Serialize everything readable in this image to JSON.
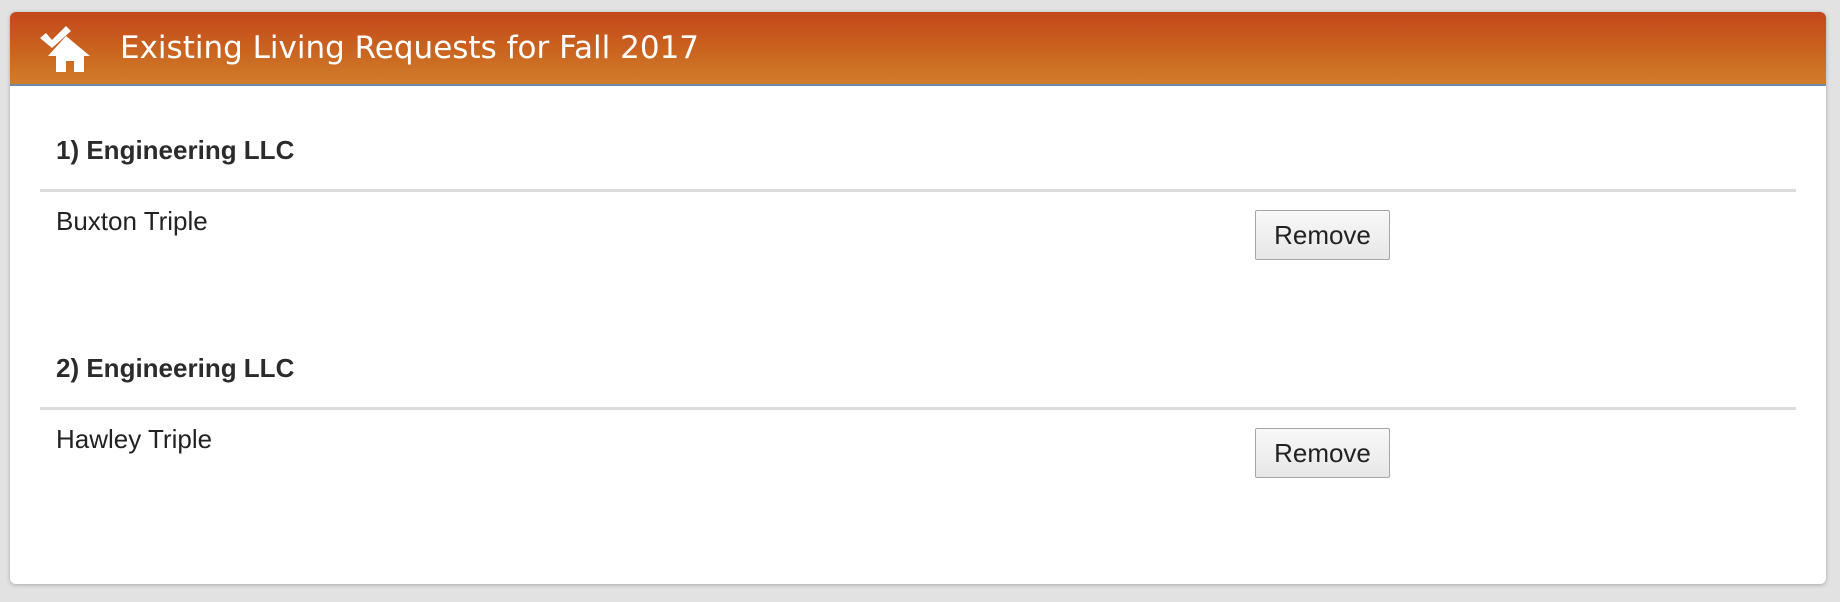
{
  "header": {
    "title": "Existing Living Requests for Fall 2017",
    "icon": "house-check-icon",
    "gradient_top": "#c4471b",
    "gradient_bottom": "#d07d2a"
  },
  "requests": [
    {
      "heading": "1) Engineering LLC",
      "room": "Buxton Triple",
      "remove_label": "Remove"
    },
    {
      "heading": "2) Engineering LLC",
      "room": "Hawley Triple",
      "remove_label": "Remove"
    }
  ]
}
